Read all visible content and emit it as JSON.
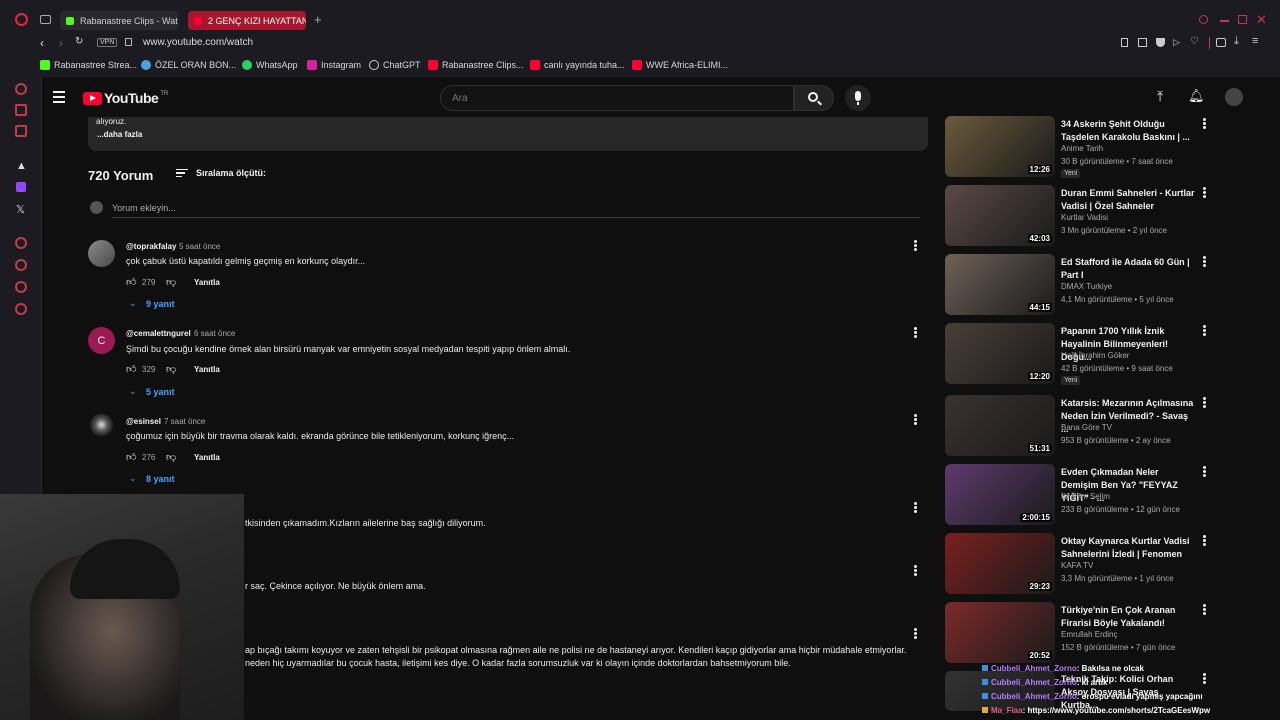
{
  "browser": {
    "tabs": [
      {
        "label": "Rabanastree Clips - Watc",
        "active": false
      },
      {
        "label": "2 GENÇ KIZI HAYATTAN K",
        "active": true
      }
    ],
    "vpn_label": "VPN",
    "url": "www.youtube.com/watch",
    "bookmarks": [
      "Rabanastree Strea...",
      "ÖZEL ORAN BON...",
      "WhatsApp",
      "Instagram",
      "ChatGPT",
      "Rabanastree Clips...",
      "canlı yayında tuha...",
      "WWE Africa-ELIMI..."
    ]
  },
  "youtube": {
    "logo_text": "YouTube",
    "logo_region": "TR",
    "search_placeholder": "Ara",
    "description_tail": "alıyoruz.",
    "more_label": "...daha fazla",
    "comments_count": "720 Yorum",
    "sort_label": "Sıralama ölçütü:",
    "add_comment_placeholder": "Yorum ekleyin...",
    "comments": [
      {
        "handle": "@toprakfalay",
        "ago": "5 saat önce",
        "text": "çok çabuk üstü kapatıldı gelmiş geçmiş en korkunç olaydır...",
        "likes": "279",
        "reply_label": "Yanıtla",
        "replies": "9 yanıt"
      },
      {
        "handle": "@cemalettngurel",
        "ago": "6 saat önce",
        "avatar_letter": "C",
        "text": "Şimdi bu çocuğu kendine örnek alan birsürü manyak var emniyetin sosyal medyadan tespiti yapıp önlem almalı.",
        "likes": "329",
        "reply_label": "Yanıtla",
        "replies": "5 yanıt"
      },
      {
        "handle": "@esinsel",
        "ago": "7 saat önce",
        "text": "çoğumuz için büyük bir travma olarak kaldı. ekranda görünce bile tetikleniyorum, korkunç iğrenç...",
        "likes": "276",
        "reply_label": "Yanıtla",
        "replies": "8 yanıt"
      }
    ],
    "partial_comments": [
      "tkisinden çıkamadım.Kızların ailelerine baş sağlığı diliyorum.",
      "r saç. Çekince açılıyor. Ne büyük önlem ama.",
      "ap bıçağı takımı koyuyor ve zaten tehşisli bir psikopat olmasına rağmen aile ne polisi ne de hastaneyi arıyor. Kendileri kaçıp gidiyorlar ama hiçbir müdahale etmiyorlar.",
      "neden hiç uyarmadılar bu çocuk hasta, iletişimi kes diye. O kadar fazla sorumsuzluk var ki olayın içinde doktorlardan bahsetmiyorum bile."
    ],
    "recommendations": [
      {
        "title": "34 Askerin Şehit Olduğu Taşdelen Karakolu Baskını | ...",
        "channel": "Anime Tarih",
        "meta": "30 B görüntüleme • 7 saat önce",
        "duration": "12:26",
        "badge": "Yeni",
        "thumb_color": "#6b5a3c"
      },
      {
        "title": "Duran Emmi Sahneleri - Kurtlar Vadisi | Özel Sahneler",
        "channel": "Kurtlar Vadisi",
        "meta": "3 Mn görüntüleme • 2 yıl önce",
        "duration": "42:03",
        "badge": "",
        "thumb_color": "#5a4a44"
      },
      {
        "title": "Ed Stafford ile Adada 60 Gün | Part I",
        "channel": "DMAX Turkiye",
        "meta": "4,1 Mn görüntüleme • 5 yıl önce",
        "duration": "44:15",
        "badge": "",
        "thumb_color": "#6e6258"
      },
      {
        "title": "Papanın 1700 Yıllık İznik Hayalinin Bilinmeyenleri! Doğu...",
        "channel": "Halil İbrahim Göker",
        "meta": "42 B görüntüleme • 9 saat önce",
        "duration": "12:20",
        "badge": "Yeni",
        "thumb_color": "#4a3f38"
      },
      {
        "title": "Katarsis: Mezarının Açılmasına Neden İzin Verilmedi? - Savaş ...",
        "channel": "Bana Göre TV",
        "meta": "953 B görüntüleme • 2 ay önce",
        "duration": "51:31",
        "badge": "",
        "thumb_color": "#3a3230"
      },
      {
        "title": "Evden Çıkmadan Neler Demişim Ben Ya? \"FEYYAZ YİĞİT\" - ...",
        "channel": "İbrahim Selim",
        "meta": "233 B görüntüleme • 12 gün önce",
        "duration": "2:00:15",
        "badge": "",
        "thumb_color": "#5e3b6e"
      },
      {
        "title": "Oktay Kaynarca Kurtlar Vadisi Sahnelerini İzledi | Fenomen",
        "channel": "KAFA TV",
        "meta": "3,3 Mn görüntüleme • 1 yıl önce",
        "duration": "29:23",
        "badge": "",
        "thumb_color": "#7a2020"
      },
      {
        "title": "Türkiye'nin En Çok Aranan Firarisi Böyle Yakalandı!",
        "channel": "Emrullah Erdinç",
        "meta": "152 B görüntüleme • 7 gün önce",
        "duration": "20:52",
        "badge": "",
        "thumb_color": "#7d2a2a"
      },
      {
        "title": "Teknik Takip: Kolici Orhan Aksoy Dosyası | Savaş Kurtba...",
        "channel": "",
        "meta": "",
        "duration": "",
        "badge": "",
        "thumb_color": "#333"
      }
    ]
  },
  "chat_overlay": [
    {
      "user": "Cubbeli_Ahmet_Zorno",
      "message": ": Bakılsa ne olcak",
      "color": "#b67cff"
    },
    {
      "user": "Cubbeli_Ahmet_Zorno",
      "message": ": ki artık",
      "color": "#b67cff"
    },
    {
      "user": "Cubbeli_Ahmet_Zorno",
      "message": ": orospu evladı yapmış yapcağını",
      "color": "#b67cff"
    },
    {
      "user": "Ma_Fiaa",
      "message": ": https://www.youtube.com/shorts/2TcaGEesWpw",
      "color": "#e85a8a"
    }
  ],
  "colors": {
    "accent_red": "#ff0033",
    "link_blue": "#3ea6ff",
    "bg": "#0f0f0f"
  }
}
